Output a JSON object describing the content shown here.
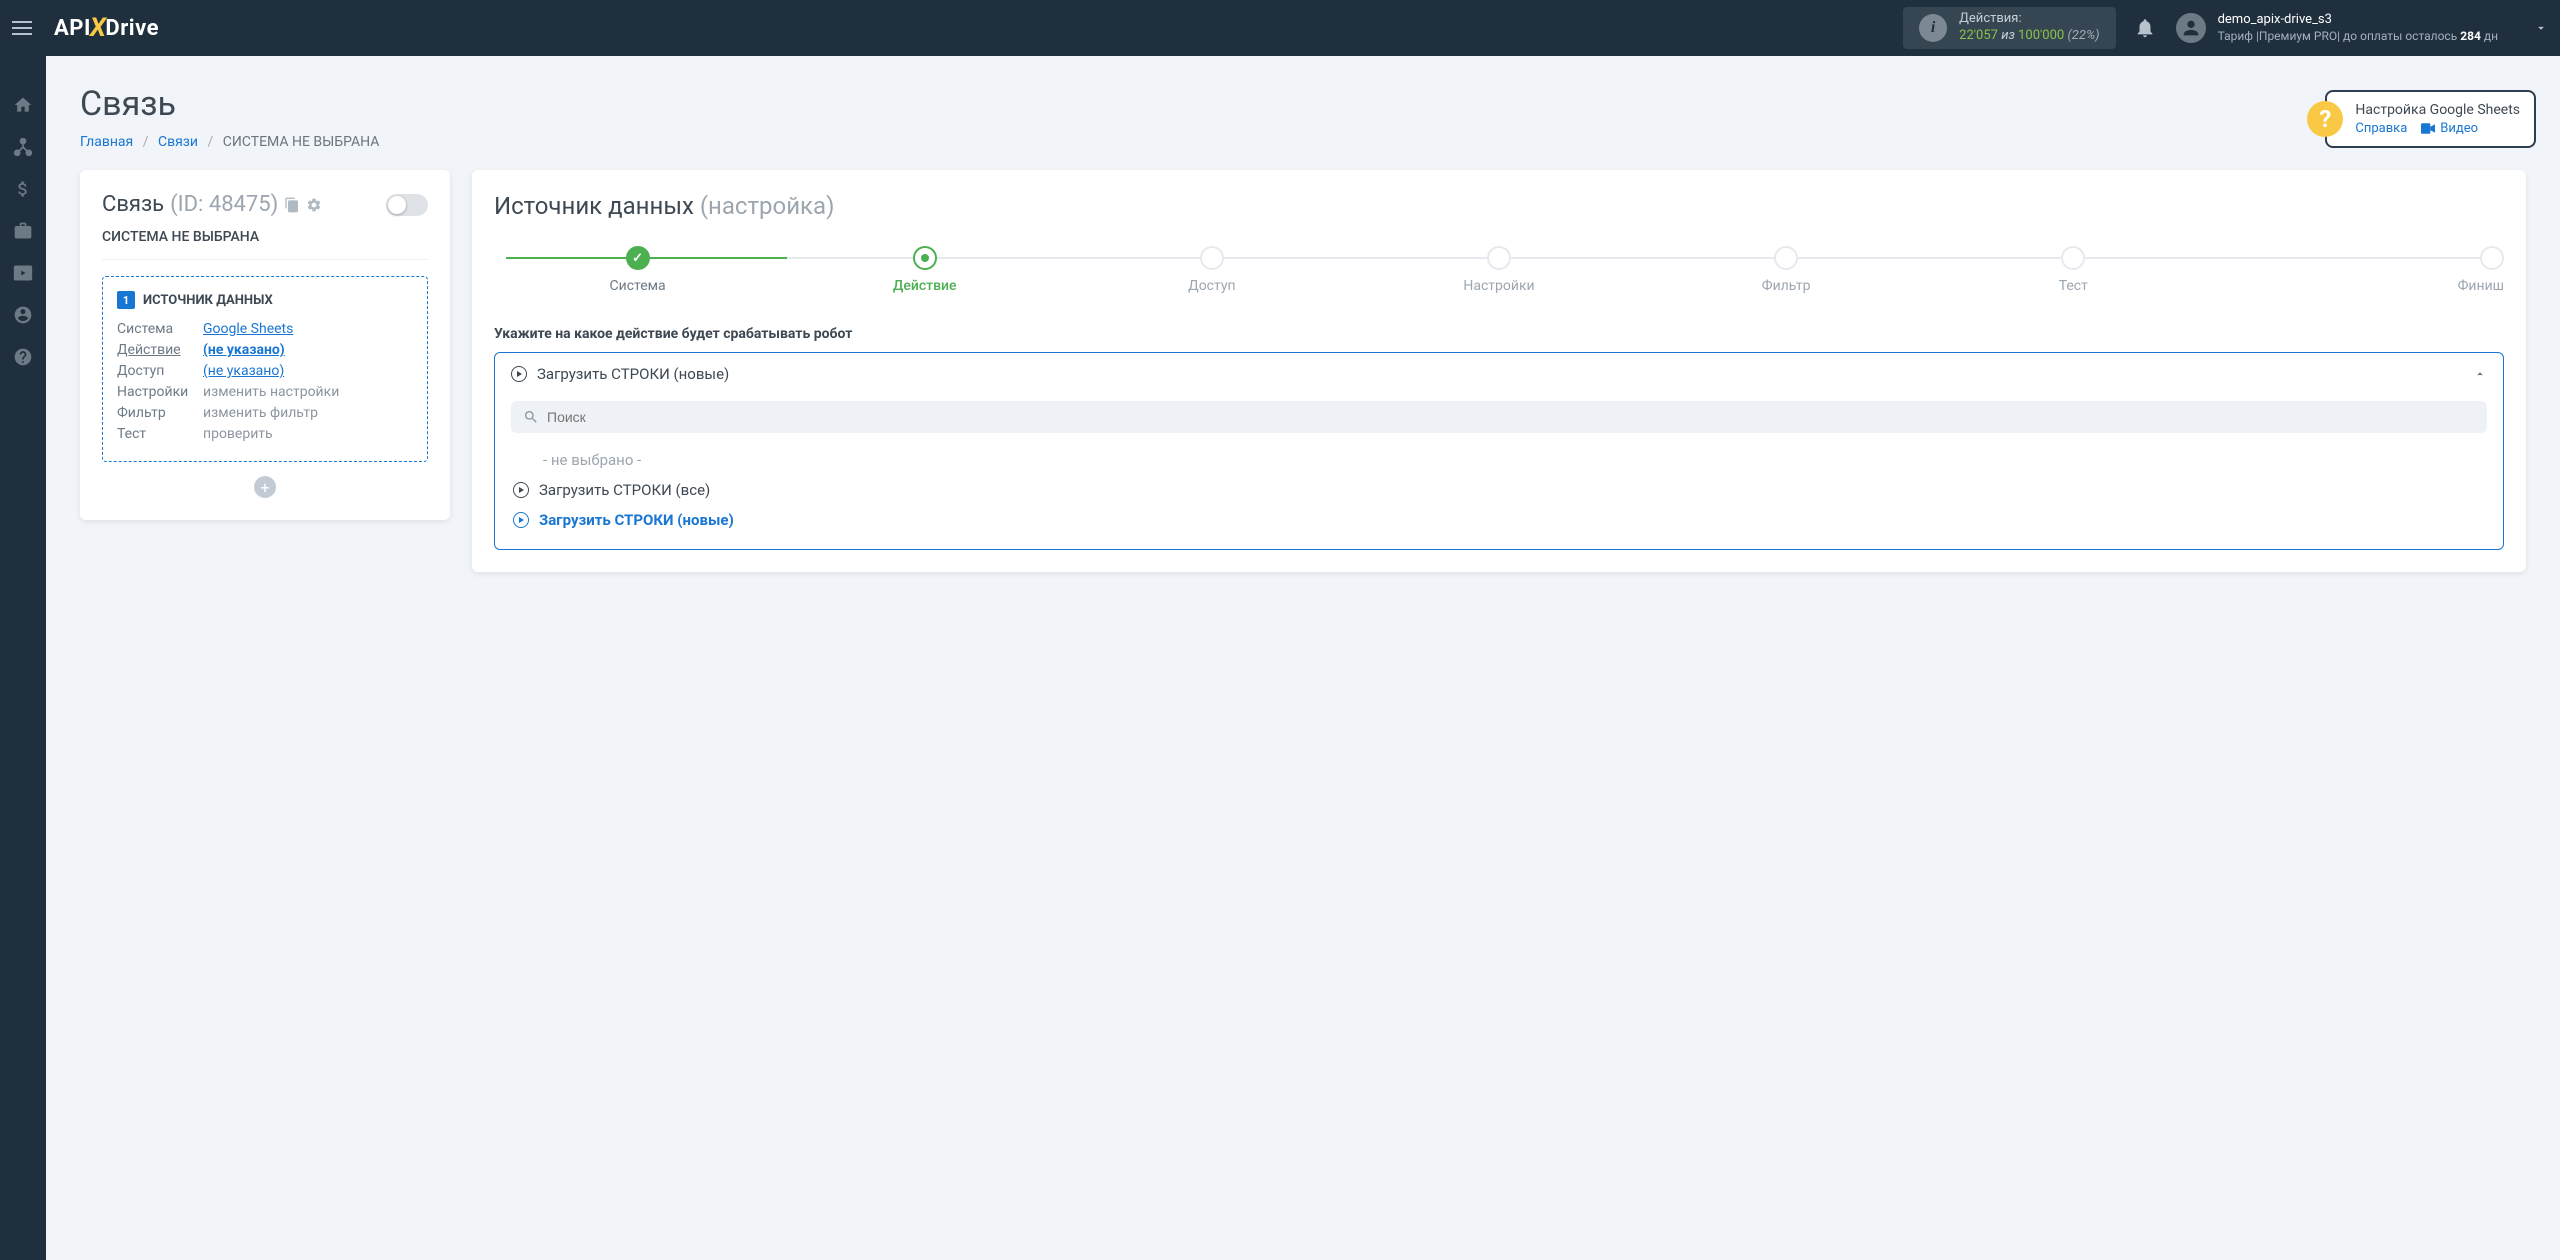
{
  "header": {
    "actions_label": "Действия:",
    "actions_current": "22'057",
    "actions_of": "из",
    "actions_total": "100'000",
    "actions_pct": "(22%)",
    "user_name": "demo_apix-drive_s3",
    "tariff_prefix": "Тариф |Премиум PRO| до оплаты осталось ",
    "tariff_days": "284",
    "tariff_suffix": " дн"
  },
  "page": {
    "title": "Связь",
    "crumb_home": "Главная",
    "crumb_conns": "Связи",
    "crumb_current": "СИСТЕМА НЕ ВЫБРАНА"
  },
  "help": {
    "title": "Настройка Google Sheets",
    "link_ref": "Справка",
    "link_video": "Видео"
  },
  "left": {
    "title": "Связь",
    "id": "(ID: 48475)",
    "subtitle": "СИСТЕМА НЕ ВЫБРАНА",
    "source_head": "ИСТОЧНИК ДАННЫХ",
    "rows": {
      "system_l": "Система",
      "system_v": "Google Sheets",
      "action_l": "Действие",
      "action_v": "(не указано)",
      "access_l": "Доступ",
      "access_v": "(не указано)",
      "settings_l": "Настройки",
      "settings_v": "изменить настройки",
      "filter_l": "Фильтр",
      "filter_v": "изменить фильтр",
      "test_l": "Тест",
      "test_v": "проверить"
    }
  },
  "right": {
    "title": "Источник данных",
    "title_sub": "(настройка)",
    "steps": [
      "Система",
      "Действие",
      "Доступ",
      "Настройки",
      "Фильтр",
      "Тест",
      "Финиш"
    ],
    "field_label": "Укажите на какое действие будет срабатывать робот",
    "selected": "Загрузить СТРОКИ (новые)",
    "search_placeholder": "Поиск",
    "opt_none": "- не выбрано -",
    "opt_all": "Загрузить СТРОКИ (все)",
    "opt_new": "Загрузить СТРОКИ (новые)"
  }
}
